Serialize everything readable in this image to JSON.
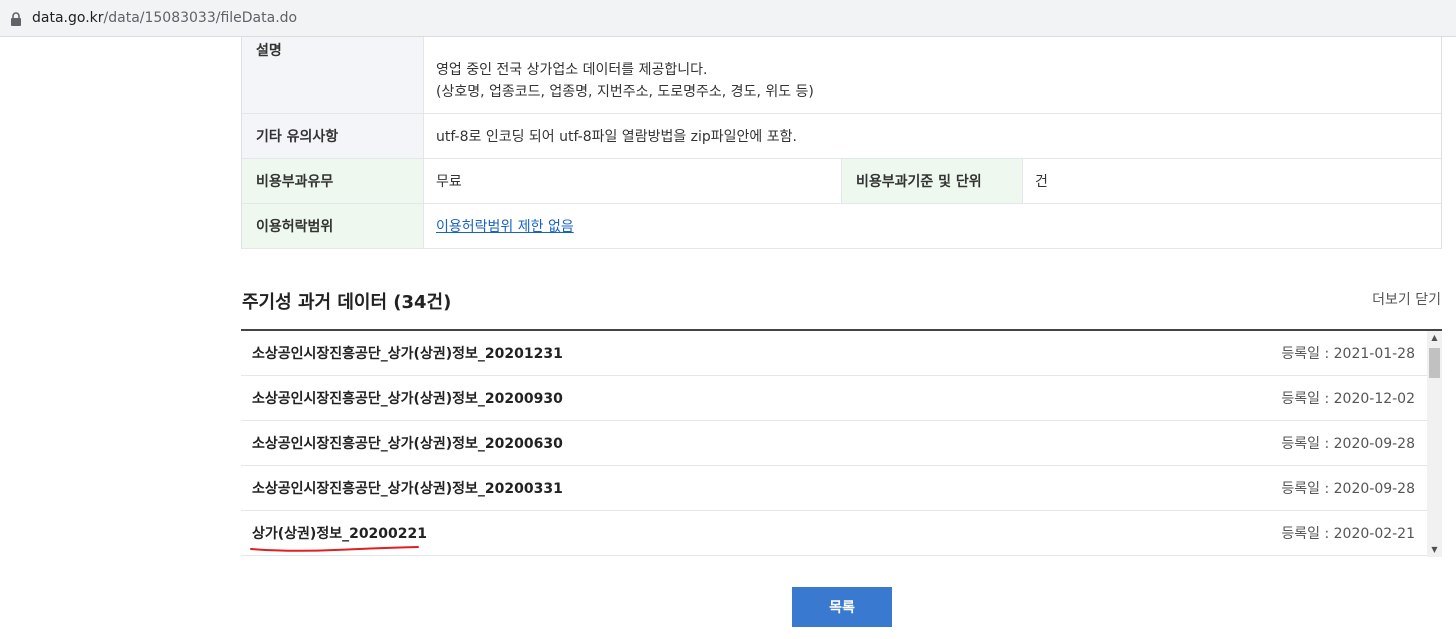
{
  "browser": {
    "url_host": "data.go.kr",
    "url_path": "/data/15083033/fileData.do"
  },
  "meta": {
    "desc_label": "설명",
    "desc_line1": "영업 중인 전국 상가업소 데이터를 제공합니다.",
    "desc_line2": "(상호명, 업종코드, 업종명, 지번주소, 도로명주소, 경도, 위도 등)",
    "etc_label": "기타 유의사항",
    "etc_value": "utf-8로 인코딩 되어 utf-8파일 열람방법을 zip파일안에 포함.",
    "fee_label": "비용부과유무",
    "fee_value": "무료",
    "fee_basis_label": "비용부과기준 및 단위",
    "fee_basis_value": "건",
    "license_label": "이용허락범위",
    "license_value": "이용허락범위 제한 없음"
  },
  "history": {
    "title": "주기성 과거 데이터 (34건)",
    "more_label": "더보기 닫기",
    "items": [
      {
        "name": "소상공인시장진흥공단_상가(상권)정보_20201231",
        "date": "등록일 : 2021-01-28"
      },
      {
        "name": "소상공인시장진흥공단_상가(상권)정보_20200930",
        "date": "등록일 : 2020-12-02"
      },
      {
        "name": "소상공인시장진흥공단_상가(상권)정보_20200630",
        "date": "등록일 : 2020-09-28"
      },
      {
        "name": "소상공인시장진흥공단_상가(상권)정보_20200331",
        "date": "등록일 : 2020-09-28"
      },
      {
        "name": "상가(상권)정보_20200221",
        "date": "등록일 : 2020-02-21"
      }
    ]
  },
  "list_button_label": "목록",
  "colors": {
    "accent_button": "#3a79d0",
    "annotation": "#e02020"
  }
}
